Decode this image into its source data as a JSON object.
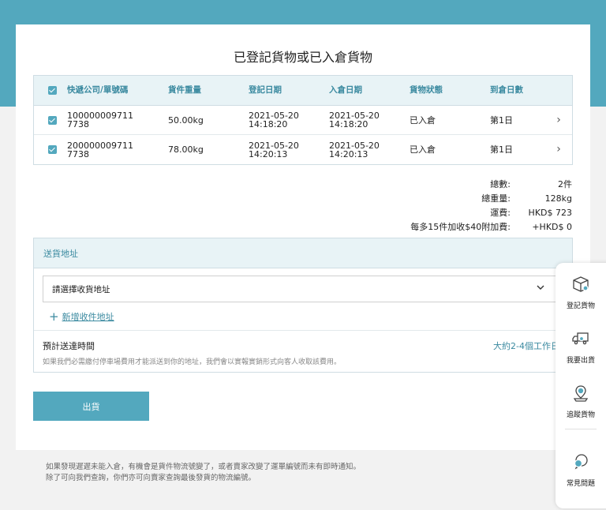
{
  "page": {
    "title": "已登記貨物或已入倉貨物"
  },
  "table": {
    "headers": {
      "courier": "快遞公司/單號碼",
      "weight": "貨件重量",
      "reg_date": "登記日期",
      "in_date": "入倉日期",
      "status": "貨物狀態",
      "days": "到倉日數"
    },
    "rows": [
      {
        "tracking_line1": "100000009711",
        "tracking_line2": "7738",
        "weight": "50.00kg",
        "reg_date": "2021-05-20",
        "reg_time": "14:18:20",
        "in_date": "2021-05-20",
        "in_time": "14:18:20",
        "status": "已入倉",
        "days": "第1日",
        "checked": true
      },
      {
        "tracking_line1": "200000009711",
        "tracking_line2": "7738",
        "weight": "78.00kg",
        "reg_date": "2021-05-20",
        "reg_time": "14:20:13",
        "in_date": "2021-05-20",
        "in_time": "14:20:13",
        "status": "已入倉",
        "days": "第1日",
        "checked": true
      }
    ]
  },
  "summary": {
    "count_label": "總數:",
    "count_value": "2件",
    "weight_label": "總重量:",
    "weight_value": "128kg",
    "fee_label": "運費:",
    "fee_value": "HKD$ 723",
    "surcharge_label": "每多15件加收$40附加費:",
    "surcharge_value": "+HKD$ 0"
  },
  "address": {
    "section_title": "送貨地址",
    "select_placeholder": "請選擇收貨地址",
    "add_link": "新增收件地址",
    "eta_label": "預計送達時間",
    "eta_value": "大約2-4個工作日",
    "note": "如果我們必需繳付停車場費用才能派送到你的地址，我們會以實報實銷形式向客人收取該費用。"
  },
  "actions": {
    "ship_button": "出貨"
  },
  "footnote": {
    "line1": "如果發現遲遲未能入倉，有機會是貨件物流號變了，或者賣家改變了運單編號而未有即時通知。",
    "line2": "除了可向我們查詢，你們亦可向賣家查詢最後發貨的物流編號。"
  },
  "sidebar": {
    "items": [
      {
        "label": "登記貨物",
        "icon": "package-icon"
      },
      {
        "label": "我要出貨",
        "icon": "truck-icon"
      },
      {
        "label": "追蹤貨物",
        "icon": "location-pin-icon"
      },
      {
        "label": "常見問題",
        "icon": "chat-bubbles-icon"
      }
    ]
  },
  "colors": {
    "accent": "#53a8be",
    "header_bg": "#e8f3f6",
    "accent_text": "#3b8aa0"
  }
}
